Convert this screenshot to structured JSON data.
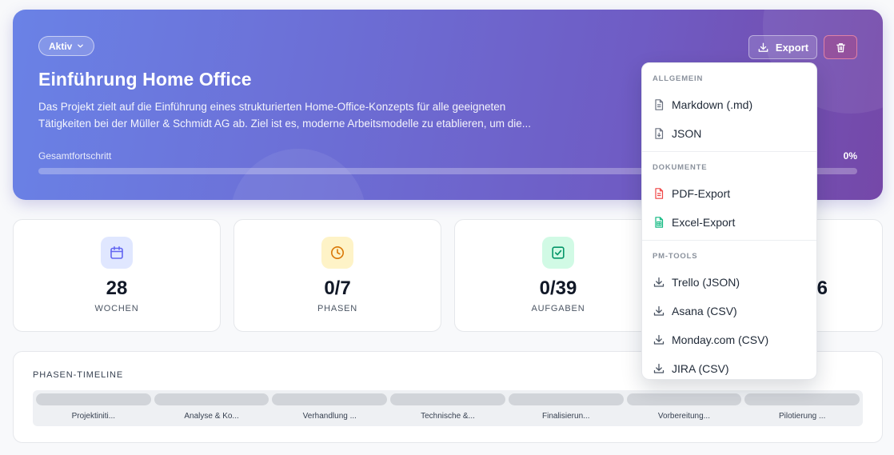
{
  "project": {
    "status": "Aktiv",
    "title": "Einführung Home Office",
    "description_line1": "Das Projekt zielt auf die Einführung eines strukturierten Home-Office-Konzepts für alle geeigneten",
    "description_line2": "Tätigkeiten bei der Müller & Schmidt AG ab. Ziel ist es, moderne Arbeitsmodelle zu etablieren, um die...",
    "progress_label": "Gesamtfortschritt",
    "progress_text": "0%",
    "progress_fraction": 0.0
  },
  "header_actions": {
    "export_label": "Export",
    "export_icon": "download-icon",
    "delete_icon": "trash-icon"
  },
  "stats": [
    {
      "value": "28",
      "label": "WOCHEN",
      "icon": "calendar-icon",
      "icon_color": "#6366f1",
      "icon_bg": "#e0e7ff"
    },
    {
      "value": "0/7",
      "label": "PHASEN",
      "icon": "clock-icon",
      "icon_color": "#d97706",
      "icon_bg": "#fef3c7"
    },
    {
      "value": "0/39",
      "label": "AUFGABEN",
      "icon": "check-square-icon",
      "icon_color": "#059669",
      "icon_bg": "#d1fae5"
    },
    {
      "value": "6",
      "label": "",
      "icon": "",
      "icon_color": "",
      "icon_bg": ""
    }
  ],
  "timeline": {
    "title": "PHASEN-TIMELINE",
    "phases": [
      "Projektiniti...",
      "Analyse & Ko...",
      "Verhandlung ...",
      "Technische &...",
      "Finalisierun...",
      "Vorbereitung...",
      "Pilotierung ..."
    ]
  },
  "export_menu": {
    "sections": [
      {
        "heading": "ALLGEMEIN",
        "items": [
          {
            "label": "Markdown (.md)",
            "icon": "file-text-icon",
            "color": "#6b7280"
          },
          {
            "label": "JSON",
            "icon": "file-code-icon",
            "color": "#6b7280"
          }
        ]
      },
      {
        "heading": "DOKUMENTE",
        "items": [
          {
            "label": "PDF-Export",
            "icon": "file-pdf-icon",
            "color": "#ef4444"
          },
          {
            "label": "Excel-Export",
            "icon": "file-spreadsheet-icon",
            "color": "#10b981"
          }
        ]
      },
      {
        "heading": "PM-TOOLS",
        "items": [
          {
            "label": "Trello (JSON)",
            "icon": "download-icon",
            "color": "#4b5563"
          },
          {
            "label": "Asana (CSV)",
            "icon": "download-icon",
            "color": "#4b5563"
          },
          {
            "label": "Monday.com (CSV)",
            "icon": "download-icon",
            "color": "#4b5563"
          },
          {
            "label": "JIRA (CSV)",
            "icon": "download-icon",
            "color": "#4b5563"
          }
        ]
      }
    ]
  }
}
